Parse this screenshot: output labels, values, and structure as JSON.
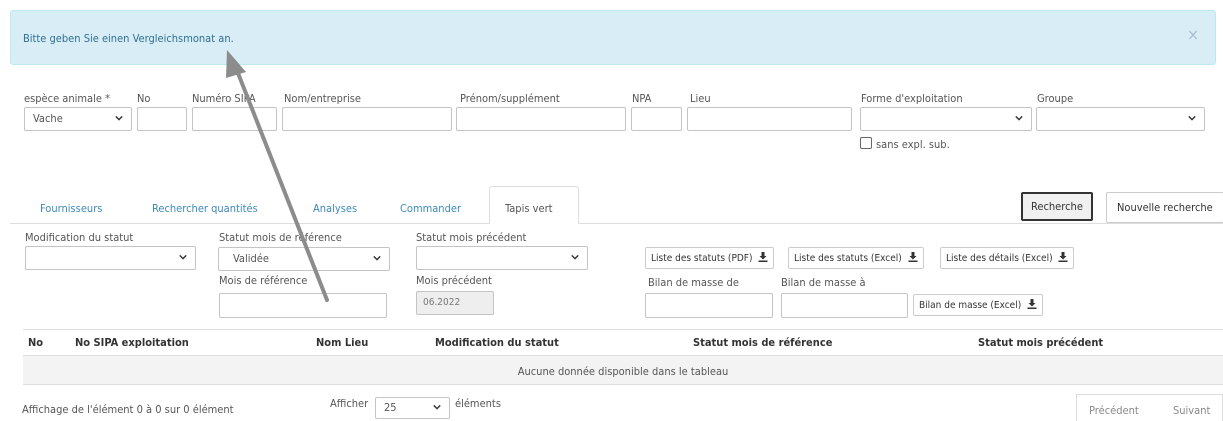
{
  "alert": {
    "message": "Bitte geben Sie einen Vergleichsmonat an.",
    "close": "×"
  },
  "filters": {
    "species_label": "espèce animale *",
    "species_value": "Vache",
    "no_label": "No",
    "sipa_label": "Numéro SIPA",
    "company_label": "Nom/entreprise",
    "firstname_label": "Prénom/supplément",
    "npa_label": "NPA",
    "place_label": "Lieu",
    "farm_form_label": "Forme d'exploitation",
    "group_label": "Groupe",
    "sans_expl_label": "sans expl. sub."
  },
  "tabs": [
    {
      "label": "Fournisseurs"
    },
    {
      "label": "Rechercher quantités"
    },
    {
      "label": "Analyses"
    },
    {
      "label": "Commander"
    },
    {
      "label": "Tapis vert"
    }
  ],
  "actions": {
    "search": "Recherche",
    "new_search": "Nouvelle recherche"
  },
  "tapis": {
    "status_change_label": "Modification du statut",
    "ref_status_label": "Statut mois de référence",
    "ref_status_value": "Validée",
    "prev_status_label": "Statut mois précédent",
    "ref_month_label": "Mois de référence",
    "prev_month_label": "Mois précédent",
    "prev_month_value": "06.2022",
    "list_pdf": "Liste des statuts (PDF)",
    "list_excel": "Liste des statuts (Excel)",
    "details_excel": "Liste des détails (Excel)",
    "mass_from_label": "Bilan de masse de",
    "mass_to_label": "Bilan de masse à",
    "mass_excel": "Bilan de masse (Excel)"
  },
  "table": {
    "columns": [
      "No",
      "No SIPA exploitation",
      "Nom Lieu",
      "Modification du statut",
      "Statut mois de référence",
      "Statut mois précédent"
    ],
    "empty": "Aucune donnée disponible dans le tableau"
  },
  "footer": {
    "info": "Affichage de l'élément 0 à 0 sur 0 élément",
    "show_label": "Afficher",
    "page_size": "25",
    "entries_label": "éléments",
    "prev": "Précédent",
    "next": "Suivant"
  },
  "colors": {
    "accent": "#3e89b6",
    "alert_bg": "#d9edf7",
    "alert_text": "#31708f",
    "annotation_arrow": "#8c8c8c"
  }
}
